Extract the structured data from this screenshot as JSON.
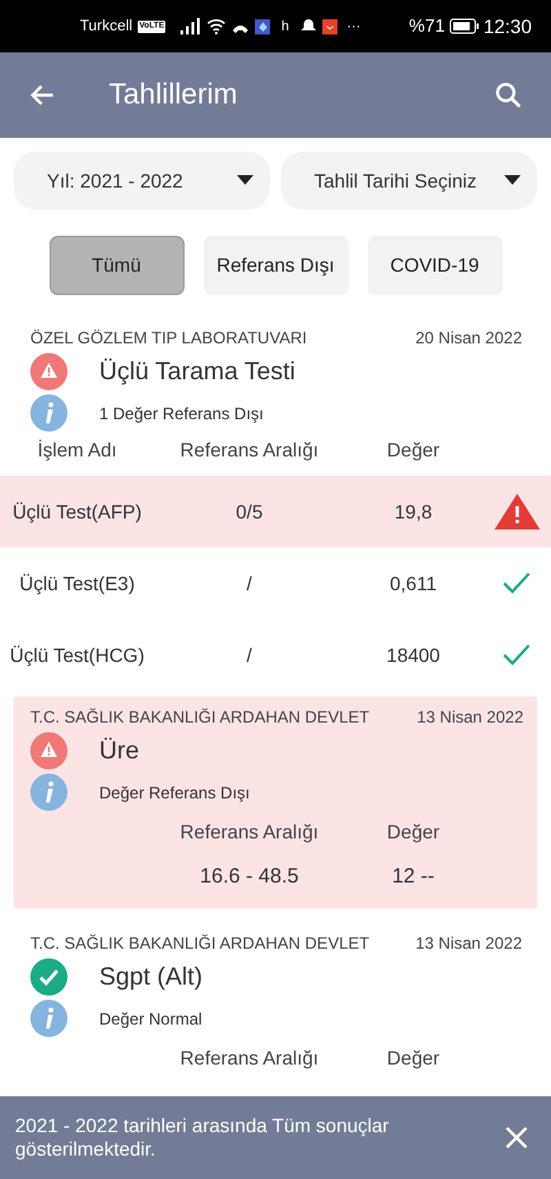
{
  "status_bar": {
    "carrier": "Turkcell",
    "volte": "VoLTE",
    "network": "h",
    "more": "···",
    "battery": "%71",
    "time": "12:30"
  },
  "app_bar": {
    "title": "Tahlillerim"
  },
  "dropdowns": [
    {
      "value": "Yıl: 2021 - 2022"
    },
    {
      "value": "Tahlil Tarihi Seçiniz"
    }
  ],
  "filters": [
    {
      "label": "Tümü",
      "selected": true
    },
    {
      "label": "Referans Dışı",
      "selected": false
    },
    {
      "label": "COVID-19",
      "selected": false
    }
  ],
  "results": [
    {
      "kind": "panel",
      "lab": "ÖZEL GÖZLEM TIP LABORATUVARI",
      "date": "20 Nisan 2022",
      "out_of_range": true,
      "title": "Üçlü Tarama Testi",
      "note": "1 Değer Referans Dışı",
      "columns": [
        "İşlem Adı",
        "Referans Aralığı",
        "Değer"
      ],
      "rows": [
        {
          "name": "Üçlü Test(AFP)",
          "range": "0/5",
          "value": "19,8",
          "out_of_range": true
        },
        {
          "name": "Üçlü Test(E3)",
          "range": "/",
          "value": "0,611",
          "out_of_range": false
        },
        {
          "name": "Üçlü Test(HCG)",
          "range": "/",
          "value": "18400",
          "out_of_range": false
        }
      ]
    },
    {
      "kind": "single",
      "lab": "T.C. SAĞLIK BAKANLIĞI ARDAHAN DEVLET",
      "date": "13 Nisan 2022",
      "out_of_range": true,
      "title": "Üre",
      "note": "Değer Referans Dışı",
      "columns": [
        "Referans Aralığı",
        "Değer"
      ],
      "range": "16.6 - 48.5",
      "value": "12 --"
    },
    {
      "kind": "single",
      "lab": "T.C. SAĞLIK BAKANLIĞI ARDAHAN DEVLET",
      "date": "13 Nisan 2022",
      "out_of_range": false,
      "title": "Sgpt (Alt)",
      "note": "Değer Normal",
      "columns": [
        "Referans Aralığı",
        "Değer"
      ]
    }
  ],
  "snackbar": {
    "message": "2021 - 2022 tarihleri arasında Tüm sonuçlar gösterilmektedir."
  }
}
